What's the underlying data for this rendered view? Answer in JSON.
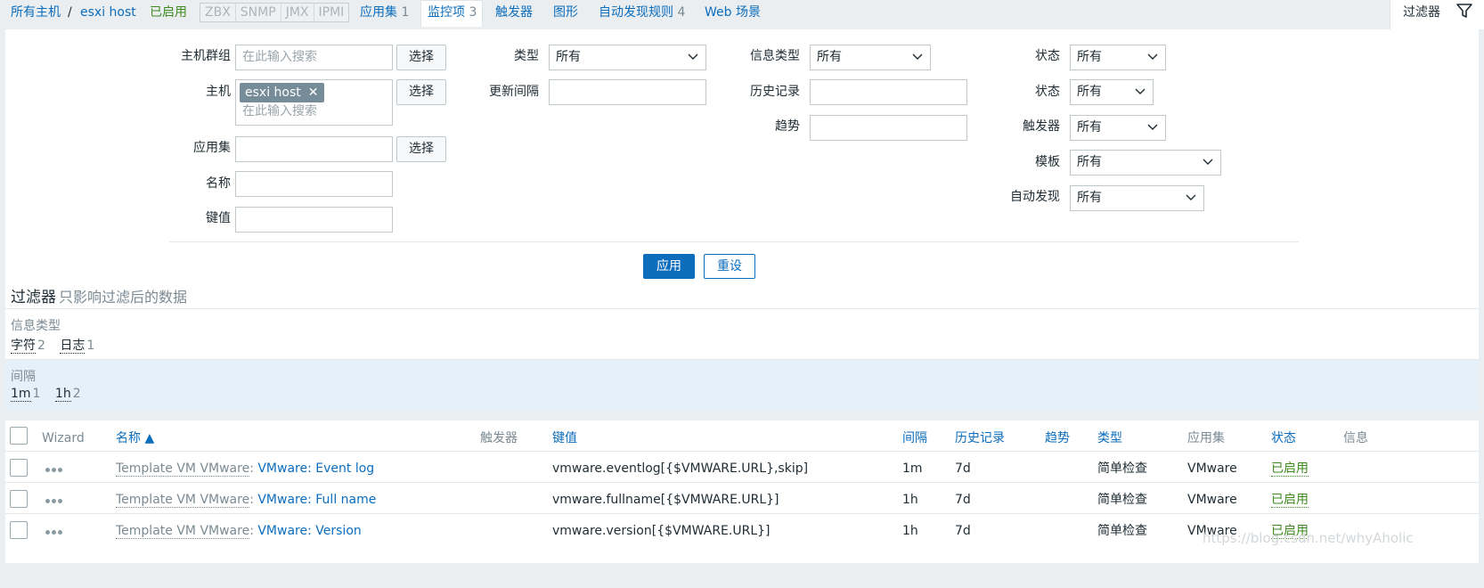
{
  "nav": {
    "all_hosts": "所有主机",
    "slash": "/",
    "host": "esxi host",
    "enabled": "已启用",
    "protocols": [
      "ZBX",
      "SNMP",
      "JMX",
      "IPMI"
    ],
    "applications_label": "应用集",
    "applications_count": "1",
    "items_label": "监控项",
    "items_count": "3",
    "triggers_label": "触发器",
    "graphs_label": "图形",
    "discovery_label": "自动发现规则",
    "discovery_count": "4",
    "web_label": "Web 场景",
    "filter_tab": "过滤器"
  },
  "filter": {
    "host_group_label": "主机群组",
    "host_group_placeholder": "在此输入搜索",
    "host_label": "主机",
    "host_tag": "esxi host",
    "host_placeholder": "在此输入搜索",
    "application_label": "应用集",
    "name_label": "名称",
    "key_label": "键值",
    "select_btn": "选择",
    "type_label": "类型",
    "type_value": "所有",
    "interval_label": "更新间隔",
    "info_type_label": "信息类型",
    "info_type_value": "所有",
    "history_label": "历史记录",
    "trends_label": "趋势",
    "state_label": "状态",
    "state_value": "所有",
    "status_label": "状态",
    "status_value": "所有",
    "triggers_label": "触发器",
    "triggers_value": "所有",
    "template_label": "模板",
    "template_value": "所有",
    "discovery_label": "自动发现",
    "discovery_value": "所有",
    "apply_btn": "应用",
    "reset_btn": "重设"
  },
  "subfilter": {
    "title": "过滤器",
    "subtitle": "只影响过滤后的数据",
    "info_type_caption": "信息类型",
    "info_types": [
      {
        "label": "字符",
        "count": "2"
      },
      {
        "label": "日志",
        "count": "1"
      }
    ],
    "interval_caption": "间隔",
    "intervals": [
      {
        "label": "1m",
        "count": "1"
      },
      {
        "label": "1h",
        "count": "2"
      }
    ]
  },
  "table": {
    "headers": {
      "wizard": "Wizard",
      "name": "名称 ▲",
      "triggers": "触发器",
      "key": "键值",
      "interval": "间隔",
      "history": "历史记录",
      "trends": "趋势",
      "type": "类型",
      "applications": "应用集",
      "status": "状态",
      "info": "信息"
    },
    "rows": [
      {
        "template": "Template VM VMware",
        "name": "VMware: Event log",
        "key": "vmware.eventlog[{$VMWARE.URL},skip]",
        "interval": "1m",
        "history": "7d",
        "type": "简单检查",
        "application": "VMware",
        "status": "已启用"
      },
      {
        "template": "Template VM VMware",
        "name": "VMware: Full name",
        "key": "vmware.fullname[{$VMWARE.URL}]",
        "interval": "1h",
        "history": "7d",
        "type": "简单检查",
        "application": "VMware",
        "status": "已启用"
      },
      {
        "template": "Template VM VMware",
        "name": "VMware: Version",
        "key": "vmware.version[{$VMWARE.URL}]",
        "interval": "1h",
        "history": "7d",
        "type": "简单检查",
        "application": "VMware",
        "status": "已启用"
      }
    ]
  },
  "watermark": "https://blog.csdn.net/whyAholic"
}
